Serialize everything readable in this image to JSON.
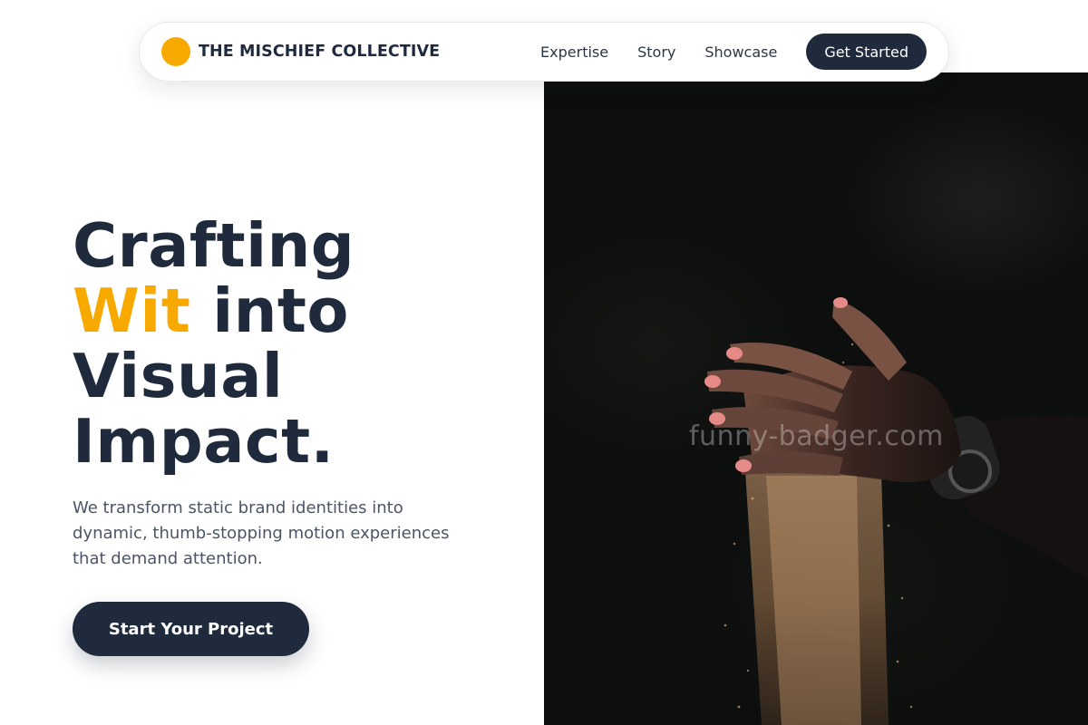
{
  "nav": {
    "brand": "THE MISCHIEF COLLECTIVE",
    "links": [
      "Expertise",
      "Story",
      "Showcase"
    ],
    "cta": "Get Started"
  },
  "hero": {
    "headline_line1": "Crafting",
    "headline_accent": "Wit",
    "headline_line2_rest": " into",
    "headline_line3": "Visual",
    "headline_line4": "Impact.",
    "subtext": "We transform static brand identities into dynamic, thumb-stopping motion experiences that demand attention.",
    "cta": "Start Your Project"
  },
  "image": {
    "description_icon": "hand-pouring-sand-photo",
    "watermark": "funny-badger.com"
  },
  "colors": {
    "accent": "#f7a900",
    "navy": "#1f2a3d",
    "muted_text": "#4b5567",
    "photo_bg": "#0d0f0e"
  }
}
